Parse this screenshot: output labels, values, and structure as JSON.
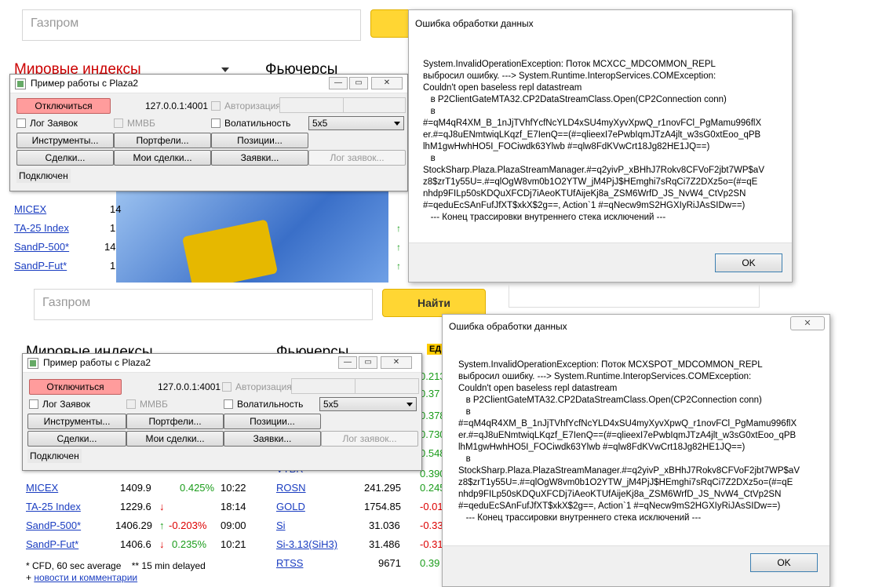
{
  "top": {
    "search_placeholder": "Газпром",
    "section_world": "Мировые индексы",
    "section_futures": "Фьючерсы",
    "index_rows": [
      {
        "name": "MICEX",
        "val": "14"
      },
      {
        "name": "TA-25 Index",
        "val": "1"
      },
      {
        "name": "SandP-500*",
        "val": "14"
      },
      {
        "name": "SandP-Fut*",
        "val": "1"
      }
    ]
  },
  "bottom": {
    "search_placeholder": "Газпром",
    "find_button": "Найти",
    "section_world": "Мировые индексы",
    "section_futures": "Фьючерсы",
    "badge": "ЕД",
    "index_rows": [
      {
        "name": "MICEX",
        "value": "1409.9",
        "arrow": "",
        "change": "0.425%",
        "time": "10:22",
        "color": "green"
      },
      {
        "name": "TA-25 Index",
        "value": "1229.6",
        "arrow": "↓",
        "change": "",
        "time": "18:14",
        "color": "red"
      },
      {
        "name": "SandP-500*",
        "value": "1406.29",
        "arrow": "↑",
        "change": "-0.203%",
        "time": "09:00",
        "color": "red"
      },
      {
        "name": "SandP-Fut*",
        "value": "1406.6",
        "arrow": "↓",
        "change": "0.235%",
        "time": "10:21",
        "color": "green"
      }
    ],
    "futures_rows": [
      {
        "name": "ROSN",
        "value": "241.295",
        "change": "0.245"
      },
      {
        "name": "GOLD",
        "value": "1754.85",
        "change": "-0.01"
      },
      {
        "name": "Si",
        "value": "31.036",
        "change": "-0.33"
      },
      {
        "name": "Si-3.13(SiH3)",
        "value": "31.486",
        "change": "-0.31"
      },
      {
        "name": "RTSS",
        "value": "9671",
        "change": "0.39"
      }
    ],
    "futures_partial_changes": [
      "0.213",
      "0.37",
      "0.378",
      "0.730",
      "0.548",
      "0.390"
    ],
    "footnote": "* CFD, 60 sec average    ** 15 min delayed",
    "link_prefix": "+ ",
    "link": "новости и комментарии"
  },
  "plaza_window": {
    "title": "Пример работы с Plaza2",
    "disconnect": "Отключиться",
    "address": "127.0.0.1:4001",
    "auth": "Авторизация",
    "log_orders": "Лог Заявок",
    "mmvb": "ММВБ",
    "volatility": "Волатильность",
    "grid_size": "5x5",
    "instruments": "Инструменты...",
    "portfolios": "Портфели...",
    "positions": "Позиции...",
    "trades": "Сделки...",
    "my_trades": "Мои сделки...",
    "orders": "Заявки...",
    "order_log": "Лог заявок...",
    "status": "Подключен"
  },
  "error_top": {
    "title": "Ошибка обработки данных",
    "message": "System.InvalidOperationException: Поток MCXCC_MDCOMMON_REPL\nвыбросил ошибку. ---> System.Runtime.InteropServices.COMException:\nCouldn't open baseless repl datastream\n   в P2ClientGateMTA32.CP2DataStreamClass.Open(CP2Connection conn)\n   в\n#=qM4qR4XM_B_1nJjTVhfYcfNcYLD4xSU4myXyvXpwQ_r1novFCl_PgMamu996flX\ner.#=qJ8uENmtwiqLKqzf_E7IenQ==(#=qlieexI7ePwbIqmJTzA4jlt_w3sG0xtEoo_qPB\nlhM1gwHwhHO5I_FOCiwdk63Ylwb #=qlw8FdKVwCrt18Jg82HE1JQ==)\n   в\nStockSharp.Plaza.PlazaStreamManager.#=q2yivP_xBHhJ7Rokv8CFVoF2jbt7WP$aV\nz8$zrT1y55U=.#=qlOgW8vm0b1O2YTW_jM4PjJ$HEmghi7sRqCi7Z2DXz5o=(#=qE\nnhdp9FILp50sKDQuXFCDj7iAeoKTUfAijeKj8a_ZSM6WrfD_JS_NvW4_CtVp2SN\n#=qeduEcSAnFufJfXT$xkX$2g==, Action`1 #=qNecw9mS2HGXIyRiJAsSIDw==)\n   --- Конец трассировки внутреннего стека исключений ---",
    "ok": "OK"
  },
  "error_bottom": {
    "title": "Ошибка обработки данных",
    "message": "System.InvalidOperationException: Поток MCXSPOT_MDCOMMON_REPL\nвыбросил ошибку. ---> System.Runtime.InteropServices.COMException:\nCouldn't open baseless repl datastream\n   в P2ClientGateMTA32.CP2DataStreamClass.Open(CP2Connection conn)\n   в\n#=qM4qR4XM_B_1nJjTVhfYcfNcYLD4xSU4myXyvXpwQ_r1novFCl_PgMamu996flX\ner.#=qJ8uENmtwiqLKqzf_E7IenQ==(#=qlieexI7ePwbIqmJTzA4jlt_w3sG0xtEoo_qPB\nlhM1gwHwhHO5I_FOCiwdk63Ylwb #=qlw8FdKVwCrt18Jg82HE1JQ==)\n   в\nStockSharp.Plaza.PlazaStreamManager.#=q2yivP_xBHhJ7Rokv8CFVoF2jbt7WP$aV\nz8$zrT1y55U=.#=qlOgW8vm0b1O2YTW_jM4PjJ$HEmghi7sRqCi7Z2DXz5o=(#=qE\nnhdp9FILp50sKDQuXFCDj7iAeoKTUfAijeKj8a_ZSM6WrfD_JS_NvW4_CtVp2SN\n#=qeduEcSAnFufJfXT$xkX$2g==, Action`1 #=qNecw9mS2HGXIyRiJAsSIDw==)\n   --- Конец трассировки внутреннего стека исключений ---",
    "ok": "OK"
  }
}
